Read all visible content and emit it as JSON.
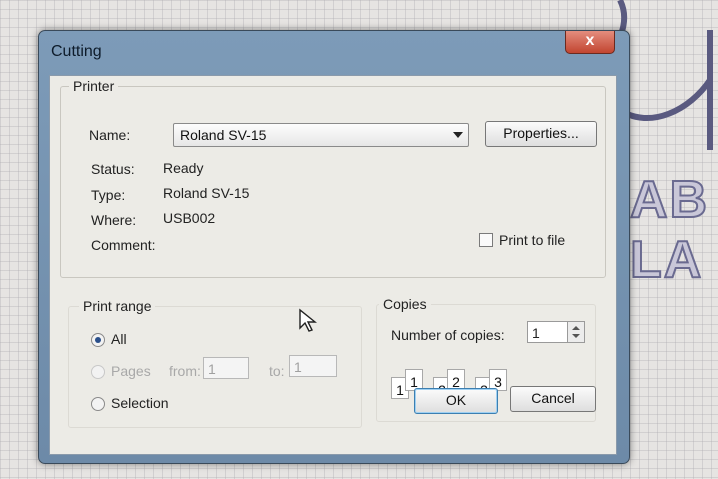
{
  "dialog": {
    "title": "Cutting",
    "close_glyph": "x"
  },
  "background_text": "AB LA",
  "printer": {
    "group_label": "Printer",
    "name_label": "Name:",
    "name_value": "Roland SV-15",
    "properties_label": "Properties...",
    "status_label": "Status:",
    "status_value": "Ready",
    "type_label": "Type:",
    "type_value": "Roland SV-15",
    "where_label": "Where:",
    "where_value": "USB002",
    "comment_label": "Comment:",
    "comment_value": "",
    "print_to_file_label": "Print to file"
  },
  "print_range": {
    "group_label": "Print range",
    "all_label": "All",
    "pages_label": "Pages",
    "from_label": "from:",
    "from_value": "1",
    "to_label": "to:",
    "to_value": "1",
    "selection_label": "Selection"
  },
  "copies": {
    "group_label": "Copies",
    "number_label": "Number of copies:",
    "number_value": "1",
    "collate_pages": [
      "1",
      "1",
      "2",
      "2",
      "3",
      "3"
    ]
  },
  "buttons": {
    "ok": "OK",
    "cancel": "Cancel"
  }
}
